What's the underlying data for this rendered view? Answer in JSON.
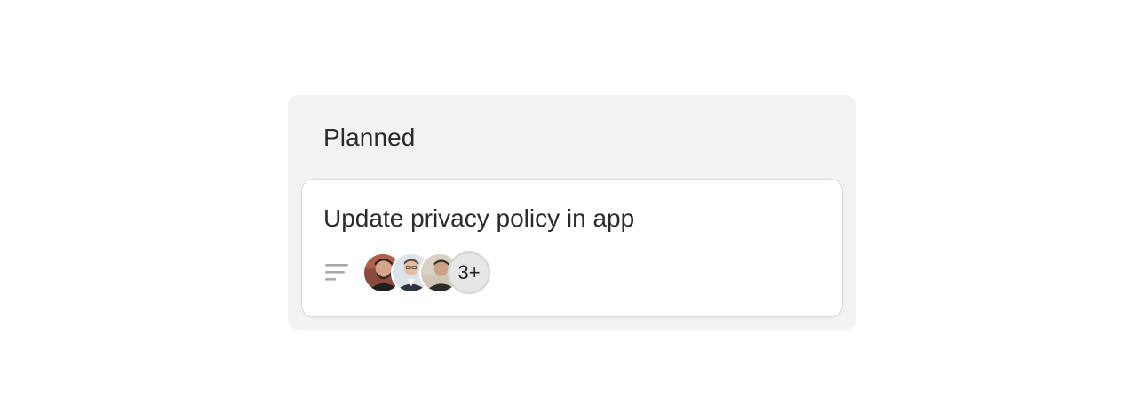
{
  "column": {
    "title": "Planned",
    "background": "#f3f3f3"
  },
  "card": {
    "title": "Update privacy policy in app",
    "description_icon": "text-lines-icon",
    "assignees": [
      {
        "name": "avatar-1"
      },
      {
        "name": "avatar-2"
      },
      {
        "name": "avatar-3"
      }
    ],
    "more_assignees_label": "3+"
  }
}
